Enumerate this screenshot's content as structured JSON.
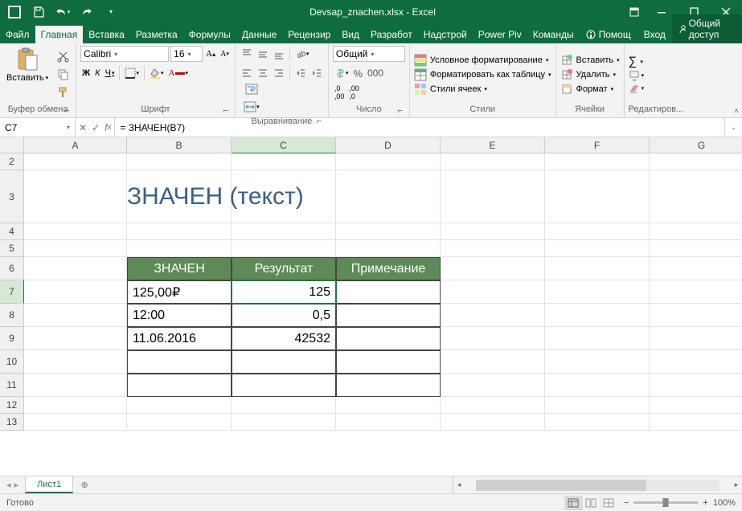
{
  "titlebar": {
    "title": "Devsap_znachen.xlsx - Excel"
  },
  "tabs": {
    "file": "Файл",
    "list": [
      "Главная",
      "Вставка",
      "Разметка",
      "Формулы",
      "Данные",
      "Рецензир",
      "Вид",
      "Разработ",
      "Надстрой",
      "Power Piv",
      "Команды"
    ],
    "active": 0,
    "help": "Помощ",
    "signin": "Вход",
    "share": "Общий доступ"
  },
  "ribbon": {
    "clipboard": {
      "paste": "Вставить",
      "label": "Буфер обмена"
    },
    "font": {
      "name": "Calibri",
      "size": "16",
      "label": "Шрифт",
      "bold": "Ж",
      "italic": "К",
      "underline": "Ч"
    },
    "align": {
      "label": "Выравнивание",
      "general": "Общий"
    },
    "number": {
      "label": "Число"
    },
    "styles": {
      "cond": "Условное форматирование",
      "table": "Форматировать как таблицу",
      "cell": "Стили ячеек",
      "label": "Стили"
    },
    "cells": {
      "insert": "Вставить",
      "delete": "Удалить",
      "format": "Формат",
      "label": "Ячейки"
    },
    "editing": {
      "label": "Редактиров..."
    }
  },
  "formula_bar": {
    "name": "C7",
    "formula": "= ЗНАЧЕН(B7)"
  },
  "grid": {
    "cols": [
      {
        "l": "A",
        "w": 128
      },
      {
        "l": "B",
        "w": 130
      },
      {
        "l": "C",
        "w": 130
      },
      {
        "l": "D",
        "w": 130
      },
      {
        "l": "E",
        "w": 130
      },
      {
        "l": "F",
        "w": 130
      },
      {
        "l": "G",
        "w": 130
      }
    ],
    "rows": [
      {
        "n": 2,
        "h": 21
      },
      {
        "n": 3,
        "h": 66
      },
      {
        "n": 4,
        "h": 21
      },
      {
        "n": 5,
        "h": 21
      },
      {
        "n": 6,
        "h": 29
      },
      {
        "n": 7,
        "h": 29
      },
      {
        "n": 8,
        "h": 29
      },
      {
        "n": 9,
        "h": 29
      },
      {
        "n": 10,
        "h": 29
      },
      {
        "n": 11,
        "h": 29
      },
      {
        "n": 12,
        "h": 21
      },
      {
        "n": 13,
        "h": 21
      }
    ]
  },
  "sheet": {
    "title": "ЗНАЧЕН (текст)",
    "headers": [
      "ЗНАЧЕН",
      "Результат",
      "Примечание"
    ],
    "rows": [
      {
        "b": "125,00₽",
        "c": "125"
      },
      {
        "b": "12:00",
        "c": "0,5"
      },
      {
        "b": "11.06.2016",
        "c": "42532"
      },
      {
        "b": "",
        "c": ""
      },
      {
        "b": "",
        "c": ""
      }
    ],
    "tab": "Лист1"
  },
  "status": {
    "ready": "Готово",
    "zoom": "100%"
  }
}
